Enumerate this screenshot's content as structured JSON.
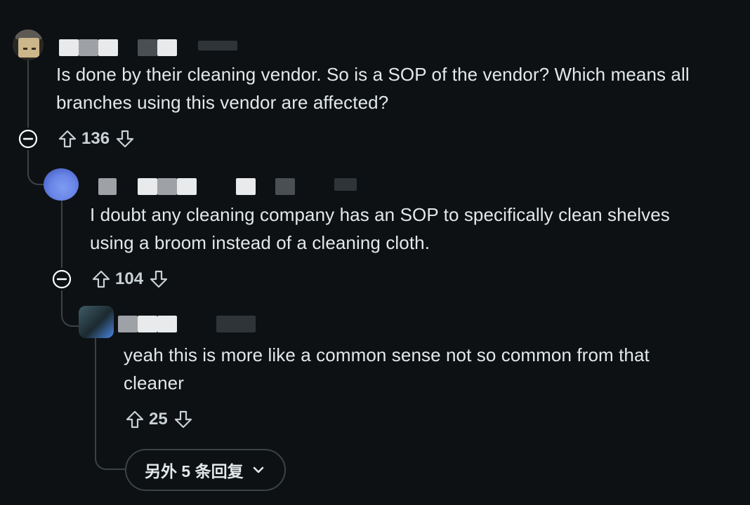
{
  "comments": [
    {
      "text_line1": "Is done by their cleaning vendor. So is a SOP of the vendor? Which means all",
      "text_line2": "branches using this vendor are affected?",
      "score": "136"
    },
    {
      "text_line1": "I doubt any cleaning company has an SOP to specifically clean shelves",
      "text_line2": "using a broom instead of a cleaning cloth.",
      "score": "104"
    },
    {
      "text_line1": "yeah this is more like a common sense not so common from that",
      "text_line2": "cleaner",
      "score": "25"
    }
  ],
  "more_replies": {
    "label": "另外 5 条回复"
  },
  "icons": {
    "upvote": "arrow-up-outline-icon",
    "downvote": "arrow-down-outline-icon",
    "collapse": "minus-circle-icon",
    "expand_chevron": "chevron-down-icon"
  },
  "colors": {
    "background": "#0e1113",
    "text": "#e3e8ea",
    "thread_line": "#3b4246"
  }
}
